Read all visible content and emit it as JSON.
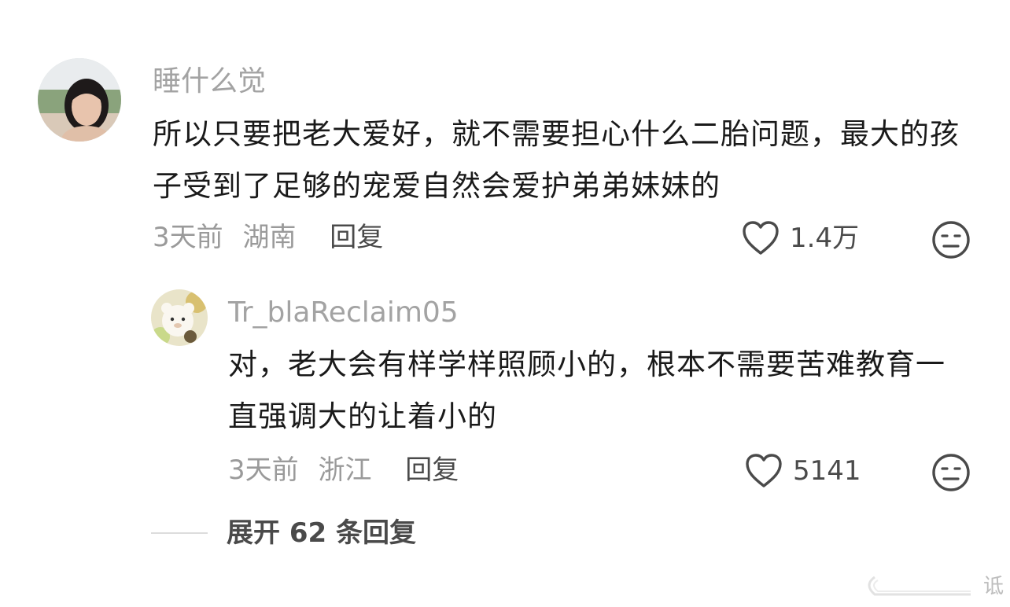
{
  "comments": [
    {
      "username": "睡什么觉",
      "text": "所以只要把老大爱好，就不需要担心什么二胎问题，最大的孩子受到了足够的宠爱自然会爱护弟弟妹妹的",
      "time": "3天前",
      "location": "湖南",
      "reply_label": "回复",
      "likes": "1.4万"
    },
    {
      "username": "Tr_blaReclaim05",
      "text": "对，老大会有样学样照顾小的，根本不需要苦难教育一直强调大的让着小的",
      "time": "3天前",
      "location": "浙江",
      "reply_label": "回复",
      "likes": "5141"
    }
  ],
  "expand": {
    "label": "展开 62 条回复"
  },
  "watermark": {
    "text": "诋"
  },
  "colors": {
    "username": "#a3a3a3",
    "body": "#1a1a1a",
    "meta": "#9a9a9a",
    "action": "#4a4a4a"
  },
  "icons": {
    "like": "heart-outline-icon",
    "dislike": "meh-face-icon"
  }
}
